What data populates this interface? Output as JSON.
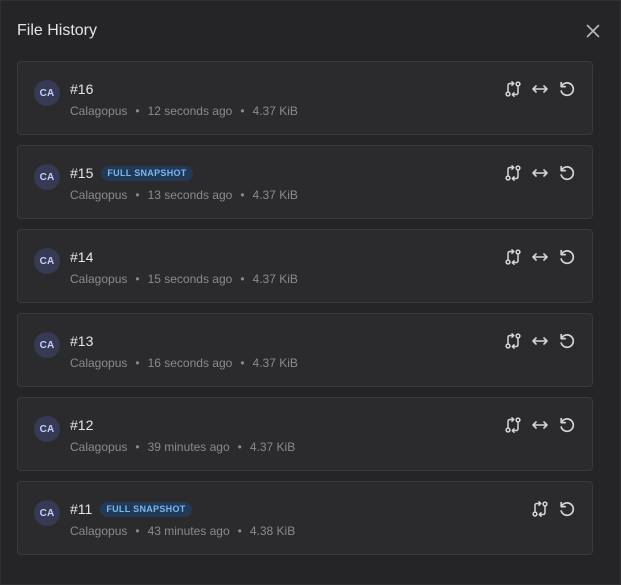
{
  "dialog": {
    "title": "File History",
    "close_icon": "close-icon"
  },
  "colors": {
    "background": "#252527",
    "card": "#2b2b2e",
    "badge_bg": "#223a55",
    "badge_text": "#7ab6f2",
    "avatar_bg": "#363a55"
  },
  "entries": [
    {
      "avatar": "CA",
      "revision": "#16",
      "badge": "",
      "user": "Calagopus",
      "time": "12 seconds ago",
      "size": "4.37 KiB",
      "icons": [
        "compare-icon",
        "arrows-horizontal-icon",
        "restore-icon"
      ]
    },
    {
      "avatar": "CA",
      "revision": "#15",
      "badge": "FULL SNAPSHOT",
      "user": "Calagopus",
      "time": "13 seconds ago",
      "size": "4.37 KiB",
      "icons": [
        "compare-icon",
        "arrows-horizontal-icon",
        "restore-icon"
      ]
    },
    {
      "avatar": "CA",
      "revision": "#14",
      "badge": "",
      "user": "Calagopus",
      "time": "15 seconds ago",
      "size": "4.37 KiB",
      "icons": [
        "compare-icon",
        "arrows-horizontal-icon",
        "restore-icon"
      ]
    },
    {
      "avatar": "CA",
      "revision": "#13",
      "badge": "",
      "user": "Calagopus",
      "time": "16 seconds ago",
      "size": "4.37 KiB",
      "icons": [
        "compare-icon",
        "arrows-horizontal-icon",
        "restore-icon"
      ]
    },
    {
      "avatar": "CA",
      "revision": "#12",
      "badge": "",
      "user": "Calagopus",
      "time": "39 minutes ago",
      "size": "4.37 KiB",
      "icons": [
        "compare-icon",
        "arrows-horizontal-icon",
        "restore-icon"
      ]
    },
    {
      "avatar": "CA",
      "revision": "#11",
      "badge": "FULL SNAPSHOT",
      "user": "Calagopus",
      "time": "43 minutes ago",
      "size": "4.38 KiB",
      "icons": [
        "compare-icon",
        "restore-icon"
      ]
    }
  ],
  "meta_separator": "•"
}
